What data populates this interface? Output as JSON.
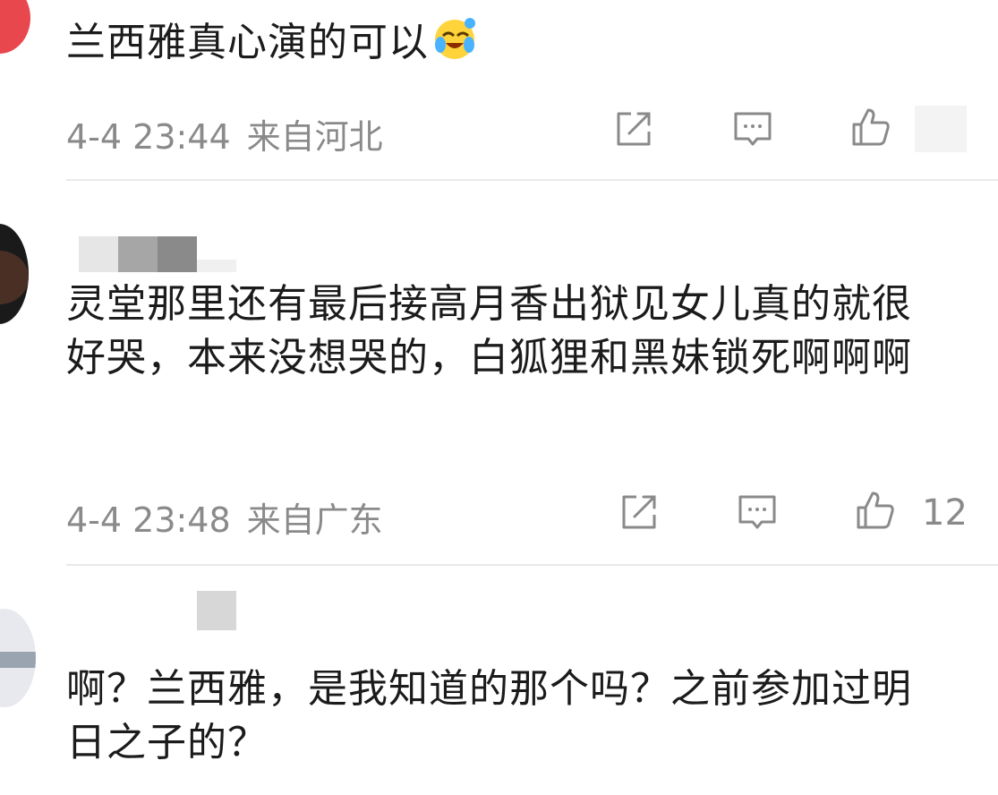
{
  "comments": [
    {
      "text": "兰西雅真心演的可以",
      "emoji": "crying-laughing-emoji",
      "time": "4-4 23:44",
      "location": "来自河北",
      "likes": ""
    },
    {
      "text": "灵堂那里还有最后接高月香出狱见女儿真的就很好哭，本来没想哭的，白狐狸和黑妹锁死啊啊啊",
      "time": "4-4 23:48",
      "location": "来自广东",
      "likes": "12"
    },
    {
      "text": "啊？兰西雅，是我知道的那个吗？之前参加过明日之子的？"
    }
  ],
  "icons": {
    "share": "share-icon",
    "reply": "comment-icon",
    "like": "thumbs-up-icon"
  },
  "colors": {
    "meta": "#8a8a8a",
    "text": "#1b1b1b",
    "avatar1": "#e8484d"
  }
}
